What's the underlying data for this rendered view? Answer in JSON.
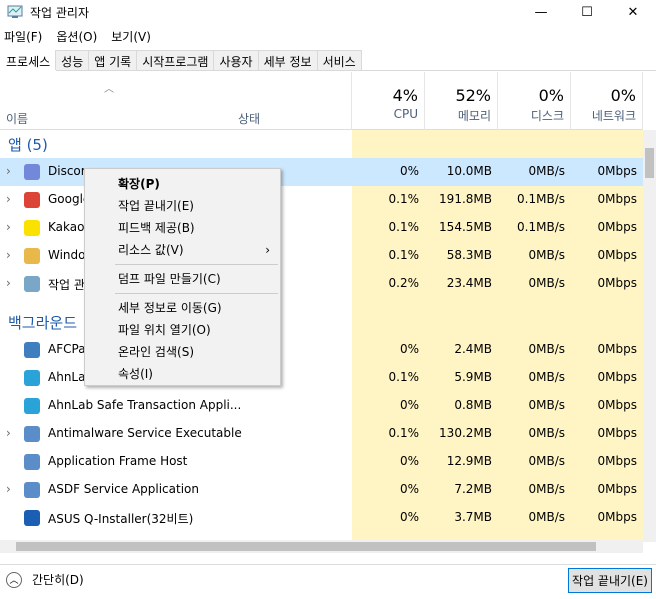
{
  "window": {
    "title": "작업 관리자",
    "minimize": "—",
    "maximize": "☐",
    "close": "✕"
  },
  "menu": [
    "파일(F)",
    "옵션(O)",
    "보기(V)"
  ],
  "tabs": [
    "프로세스",
    "성능",
    "앱 기록",
    "시작프로그램",
    "사용자",
    "세부 정보",
    "서비스"
  ],
  "header": {
    "name": "이름",
    "status": "상태",
    "cpu": {
      "pct": "4%",
      "label": "CPU"
    },
    "memory": {
      "pct": "52%",
      "label": "메모리"
    },
    "disk": {
      "pct": "0%",
      "label": "디스크"
    },
    "network": {
      "pct": "0%",
      "label": "네트워크"
    }
  },
  "groups": {
    "apps": "앱 (5)",
    "background": "백그라운드"
  },
  "apps": [
    {
      "name": "Discor",
      "cpu": "0%",
      "mem": "10.0MB",
      "disk": "0MB/s",
      "net": "0Mbps",
      "color": "#7289da"
    },
    {
      "name": "Google",
      "cpu": "0.1%",
      "mem": "191.8MB",
      "disk": "0.1MB/s",
      "net": "0Mbps",
      "color": "#db4437"
    },
    {
      "name": "KakaoT",
      "cpu": "0.1%",
      "mem": "154.5MB",
      "disk": "0.1MB/s",
      "net": "0Mbps",
      "color": "#fae100"
    },
    {
      "name": "Windo",
      "cpu": "0.1%",
      "mem": "58.3MB",
      "disk": "0MB/s",
      "net": "0Mbps",
      "color": "#e8b84a"
    },
    {
      "name": "작업 관",
      "cpu": "0.2%",
      "mem": "23.4MB",
      "disk": "0MB/s",
      "net": "0Mbps",
      "color": "#7aa6c8"
    }
  ],
  "background": [
    {
      "name": "AFCPa",
      "cpu": "0%",
      "mem": "2.4MB",
      "disk": "0MB/s",
      "net": "0Mbps",
      "color": "#3f7fbf",
      "chev": false
    },
    {
      "name": "AhnLa",
      "cpu": "0.1%",
      "mem": "5.9MB",
      "disk": "0MB/s",
      "net": "0Mbps",
      "color": "#2aa3d8",
      "chev": false
    },
    {
      "name": "AhnLab Safe Transaction Appli...",
      "cpu": "0%",
      "mem": "0.8MB",
      "disk": "0MB/s",
      "net": "0Mbps",
      "color": "#2aa3d8",
      "chev": false
    },
    {
      "name": "Antimalware Service Executable",
      "cpu": "0.1%",
      "mem": "130.2MB",
      "disk": "0MB/s",
      "net": "0Mbps",
      "color": "#5b8dc9",
      "chev": true
    },
    {
      "name": "Application Frame Host",
      "cpu": "0%",
      "mem": "12.9MB",
      "disk": "0MB/s",
      "net": "0Mbps",
      "color": "#5b8dc9",
      "chev": false
    },
    {
      "name": "ASDF Service Application",
      "cpu": "0%",
      "mem": "7.2MB",
      "disk": "0MB/s",
      "net": "0Mbps",
      "color": "#5b8dc9",
      "chev": true
    },
    {
      "name": "ASUS Q-Installer(32비트)",
      "cpu": "0%",
      "mem": "3.7MB",
      "disk": "0MB/s",
      "net": "0Mbps",
      "color": "#1a5fb4",
      "chev": false
    }
  ],
  "context_menu": [
    "확장(P)",
    "작업 끝내기(E)",
    "피드백 제공(B)",
    "리소스 값(V)",
    "덤프 파일 만들기(C)",
    "세부 정보로 이동(G)",
    "파일 위치 열기(O)",
    "온라인 검색(S)",
    "속성(I)"
  ],
  "footer": {
    "fewer": "간단히(D)",
    "end_task": "작업 끝내기(E)"
  }
}
